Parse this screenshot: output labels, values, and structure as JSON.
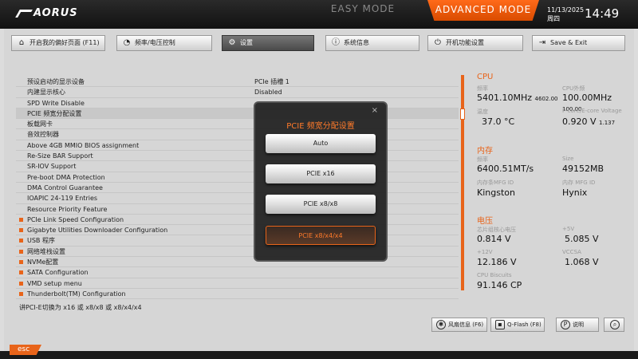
{
  "brand": {
    "logo": "AORUS"
  },
  "modes": {
    "easy": "EASY MODE",
    "advanced": "ADVANCED MODE"
  },
  "datetime": {
    "date": "11/13/2025",
    "weekday": "周四",
    "time": "14:49"
  },
  "menu": [
    {
      "label": "开启我的偏好页面 (F11)",
      "icon": "home-icon"
    },
    {
      "label": "频率/电压控制",
      "icon": "speedometer-icon"
    },
    {
      "label": "设置",
      "icon": "gear-icon"
    },
    {
      "label": "系统信息",
      "icon": "info-icon"
    },
    {
      "label": "开机功能设置",
      "icon": "power-icon"
    },
    {
      "label": "Save & Exit",
      "icon": "exit-icon"
    }
  ],
  "settings": [
    {
      "label": "预设启动的显示设备",
      "value": "PCIe 插槽 1",
      "bullet": false
    },
    {
      "label": "内建显示核心",
      "value": "Disabled",
      "bullet": false
    },
    {
      "label": "SPD Write Disable",
      "value": "",
      "bullet": false
    },
    {
      "label": "PCIE 频宽分配设置",
      "value": "",
      "bullet": false
    },
    {
      "label": "板载网卡",
      "value": "",
      "bullet": false
    },
    {
      "label": "音效控制器",
      "value": "",
      "bullet": false
    },
    {
      "label": "Above 4GB MMIO BIOS assignment",
      "value": "",
      "bullet": false
    },
    {
      "label": "Re-Size BAR Support",
      "value": "",
      "bullet": false
    },
    {
      "label": "SR-IOV Support",
      "value": "",
      "bullet": false
    },
    {
      "label": "Pre-boot DMA Protection",
      "value": "",
      "bullet": false
    },
    {
      "label": "DMA Control Guarantee",
      "value": "",
      "bullet": false
    },
    {
      "label": "IOAPIC 24-119 Entries",
      "value": "",
      "bullet": false
    },
    {
      "label": "Resource Priority Feature",
      "value": "",
      "bullet": false
    },
    {
      "label": "PCIe Link Speed Configuration",
      "value": "",
      "bullet": true
    },
    {
      "label": "Gigabyte Utilities Downloader Configuration",
      "value": "",
      "bullet": true
    },
    {
      "label": "USB 程序",
      "value": "",
      "bullet": true
    },
    {
      "label": "网络堆栈设置",
      "value": "",
      "bullet": true
    },
    {
      "label": "NVMe配置",
      "value": "",
      "bullet": true
    },
    {
      "label": "SATA Configuration",
      "value": "",
      "bullet": true
    },
    {
      "label": "VMD setup menu",
      "value": "",
      "bullet": true
    },
    {
      "label": "Thunderbolt(TM) Configuration",
      "value": "",
      "bullet": true
    }
  ],
  "hint": "讲PCI-E切换为 x16 或 x8/x8 或 x8/x4/x4",
  "info": {
    "cpu": {
      "title": "CPU",
      "freq_label": "频率",
      "freq": "5401.10MHz",
      "freq_sub": "4602.00",
      "ext_label": "CPU外频",
      "ext": "100.00MHz",
      "ext_sub": "100.00",
      "temp_label": "温度",
      "temp": "37.0 °C",
      "volt_label": "P-core/E-core Voltage",
      "volt": "0.920 V",
      "volt_sub": "1.137"
    },
    "mem": {
      "title": "内存",
      "freq_label": "频率",
      "freq": "6400.51MT/s",
      "size_label": "Size",
      "size": "49152MB",
      "mfg_label": "内存条MFG ID",
      "mfg": "Kingston",
      "mfg2_label": "内存 MFG ID",
      "mfg2": "Hynix"
    },
    "volt": {
      "title": "电压",
      "chipset_label": "芯片组核心电压",
      "chipset": "0.814 V",
      "p5_label": "+5V",
      "p5": "5.085 V",
      "p12_label": "+12V",
      "p12": "12.186 V",
      "vccsa_label": "VCCSA",
      "vccsa": "1.068 V",
      "biscuits_label": "CPU Biscuits",
      "biscuits": "91.146 CP"
    }
  },
  "bottom_buttons": [
    {
      "label": "风扇信息 (F6)",
      "icon": "fan-icon"
    },
    {
      "label": "Q-Flash (F8)",
      "icon": "flash-icon"
    },
    {
      "label": "说明",
      "icon": "help-icon"
    },
    {
      "label": "",
      "icon": "search-icon"
    }
  ],
  "esc": "esc",
  "modal": {
    "title": "PCIE 频宽分配设置",
    "options": [
      "Auto",
      "PCIE x16",
      "PCIE x8/x8",
      "PCIE x8/x4/x4"
    ],
    "selected_index": 3,
    "close": "×"
  },
  "colors": {
    "accent": "#e8641a",
    "topbar": "#111111",
    "panel": "#d6d6d6"
  }
}
